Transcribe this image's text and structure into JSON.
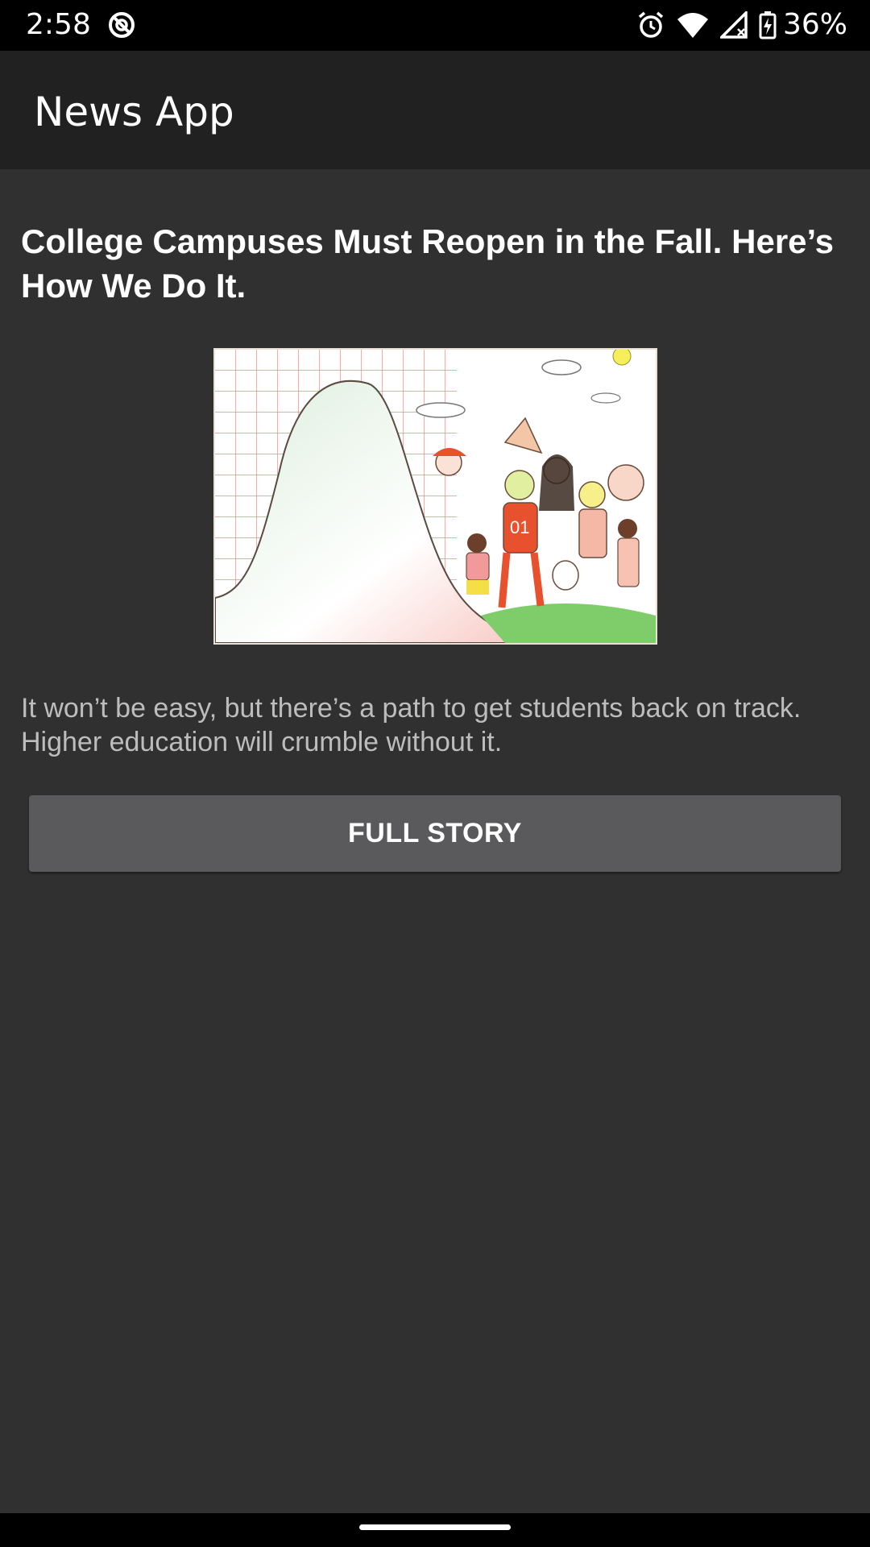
{
  "status_bar": {
    "time": "2:58",
    "battery_percent": "36%",
    "icons": [
      "assistant-circle-icon",
      "alarm-icon",
      "wifi-icon",
      "cell-signal-icon",
      "battery-charging-icon"
    ]
  },
  "app_bar": {
    "title": "News App"
  },
  "article": {
    "headline": "College Campuses Must Reopen in the Fall. Here’s How We Do It.",
    "summary": "It won’t be easy, but there’s a path to get students back on track. Higher education will crumble without it.",
    "button_label": "FULL STORY"
  },
  "colors": {
    "status_bar": "#000000",
    "app_bar": "#212121",
    "background": "#303030",
    "button": "#5a5a5c",
    "summary_text": "#bdbdbd"
  }
}
